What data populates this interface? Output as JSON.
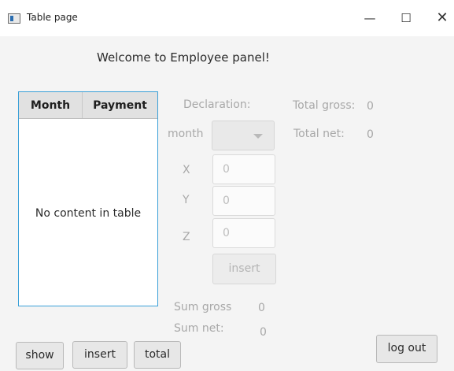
{
  "window": {
    "title": "Table page",
    "controls": {
      "minimize": "—",
      "maximize": "☐",
      "close": "✕"
    }
  },
  "welcome_text": "Welcome to Employee panel!",
  "table": {
    "columns": [
      "Month",
      "Payment"
    ],
    "rows": [],
    "empty_message": "No content in table"
  },
  "form": {
    "declaration_label": "Declaration:",
    "month_label": "month",
    "month_selected": "",
    "x_label": "X",
    "x_placeholder": "0",
    "y_label": "Y",
    "y_placeholder": "0",
    "z_label": "Z",
    "z_placeholder": "0",
    "insert_label": "insert"
  },
  "totals": {
    "total_gross_label": "Total gross:",
    "total_gross_value": "0",
    "total_net_label": "Total net:",
    "total_net_value": "0"
  },
  "sums": {
    "sum_gross_label": "Sum gross",
    "sum_gross_value": "0",
    "sum_net_label": "Sum net:",
    "sum_net_value": "0"
  },
  "buttons": {
    "show": "show",
    "insert": "insert",
    "total": "total",
    "logout": "log out"
  },
  "colors": {
    "table_border_focus": "#3aa0d8",
    "background": "#f4f4f4"
  }
}
